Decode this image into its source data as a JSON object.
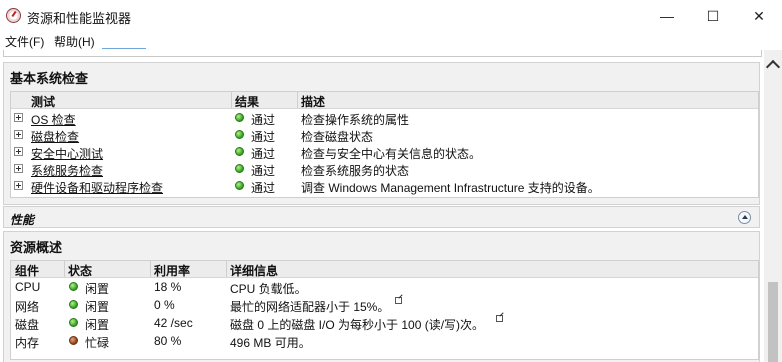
{
  "window": {
    "title": "资源和性能监视器",
    "minimize": "—",
    "maximize": "☐",
    "close": "✕"
  },
  "menu": {
    "file": "文件(F)",
    "help": "帮助(H)"
  },
  "basic_checks": {
    "title": "基本系统检查",
    "columns": {
      "test": "测试",
      "result": "结果",
      "description": "描述"
    },
    "rows": [
      {
        "test": "OS 检查",
        "status": "green",
        "result": "通过",
        "description": "检查操作系统的属性"
      },
      {
        "test": "磁盘检查",
        "status": "green",
        "result": "通过",
        "description": "检查磁盘状态"
      },
      {
        "test": "安全中心测试",
        "status": "green",
        "result": "通过",
        "description": "检查与安全中心有关信息的状态。"
      },
      {
        "test": "系统服务检查",
        "status": "green",
        "result": "通过",
        "description": "检查系统服务的状态"
      },
      {
        "test": "硬件设备和驱动程序检查",
        "status": "green",
        "result": "通过",
        "description": "调查 Windows Management Infrastructure 支持的设备。"
      }
    ]
  },
  "performance": {
    "title": "性能"
  },
  "resource_overview": {
    "title": "资源概述",
    "columns": {
      "component": "组件",
      "status": "状态",
      "utilization": "利用率",
      "details": "详细信息"
    },
    "rows": [
      {
        "component": "CPU",
        "status_color": "green",
        "status": "闲置",
        "utilization": "18 %",
        "details": "CPU 负载低。",
        "has_edit": false
      },
      {
        "component": "网络",
        "status_color": "green",
        "status": "闲置",
        "utilization": "0 %",
        "details": "最忙的网络适配器小于 15%。",
        "has_edit": true
      },
      {
        "component": "磁盘",
        "status_color": "green",
        "status": "闲置",
        "utilization": "42 /sec",
        "details": "磁盘 0 上的磁盘 I/O 为每秒小于 100 (读/写)次。",
        "has_edit": true
      },
      {
        "component": "内存",
        "status_color": "brown",
        "status": "忙碌",
        "utilization": "80 %",
        "details": "496 MB 可用。",
        "has_edit": false
      }
    ]
  },
  "colors": {
    "status_green": "#2e9d1e",
    "status_brown": "#8a3d14",
    "header_bg": "#f1f1f1"
  }
}
